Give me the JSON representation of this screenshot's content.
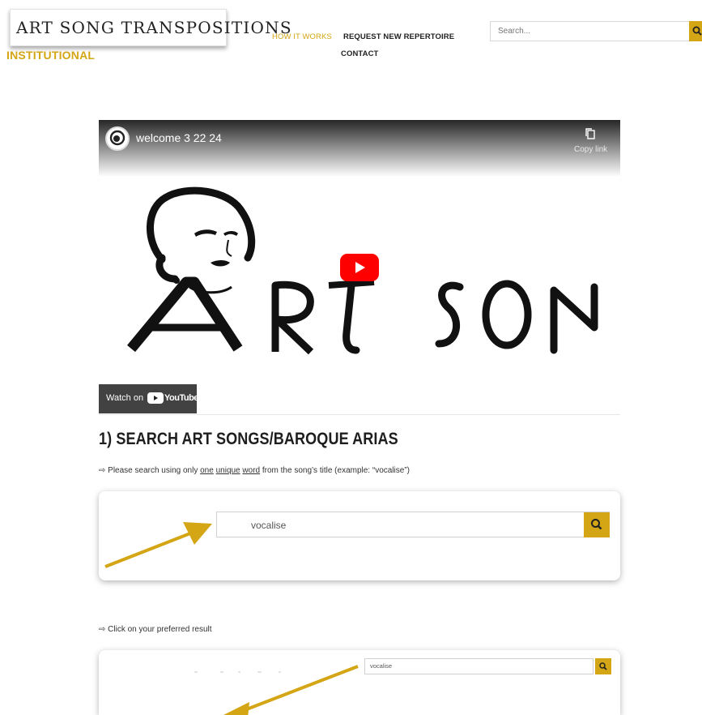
{
  "header": {
    "logo_title": "ART SONG TRANSPOSITIONS",
    "logo_sub": "INSTITUTIONAL",
    "nav": [
      {
        "label": "HOW IT WORKS",
        "active": true
      },
      {
        "label": "REQUEST NEW REPERTOIRE",
        "active": false
      },
      {
        "label": "CONTACT",
        "active": false
      }
    ],
    "search_placeholder": "Search...",
    "search_icon": "search-icon"
  },
  "video": {
    "title": "welcome 3 22 24",
    "copy_link_label": "Copy link",
    "watch_on_label": "Watch on",
    "youtube_label": "YouTube",
    "art_text": "ART SON"
  },
  "section": {
    "heading": "1) SEARCH ART SONGS/BAROQUE ARIAS",
    "instruction1": {
      "prefix": "⇨ Please search using only ",
      "word1": "one",
      "word2": "unique",
      "word3": "word",
      "suffix": " from the song’s title (example: “vocalise”)"
    },
    "example_query": "vocalise",
    "instruction2": "⇨ Click on your preferred result",
    "example_query2": "vocalise"
  },
  "colors": {
    "accent": "#d4a615",
    "arrow": "#d4a615"
  }
}
